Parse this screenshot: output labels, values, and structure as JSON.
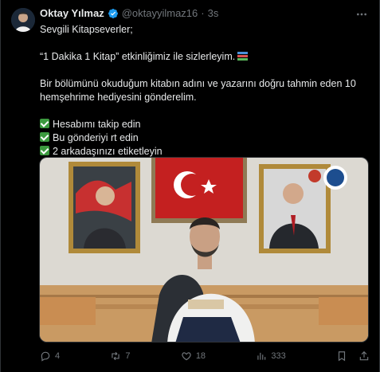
{
  "tweet": {
    "author_name": "Oktay Yılmaz",
    "handle": "@oktayyilmaz16",
    "separator": "·",
    "time": "3s",
    "lines": {
      "greeting": "Sevgili Kitapseverler;",
      "event": "“1 Dakika 1 Kitap” etkinliğimiz ile sizlerleyim.",
      "instruction": "Bir bölümünü okuduğum kitabın adını ve yazarını doğru tahmin eden 10 hemşehrime hediyesini gönderelim.",
      "step1": "Hesabımı takip edin",
      "step2": "Bu gönderiyi rt edin",
      "step3": "2 arkadaşınızı etiketleyin"
    }
  },
  "actions": {
    "replies": "4",
    "reposts": "7",
    "likes": "18",
    "views": "333"
  },
  "icons": {
    "verified": "verified-badge-icon",
    "more": "more-horizontal-icon",
    "reply": "reply-icon",
    "repost": "repost-icon",
    "like": "heart-icon",
    "views": "views-chart-icon",
    "bookmark": "bookmark-icon",
    "share": "share-icon",
    "books": "books-emoji-icon",
    "check": "check-mark-emoji-icon"
  },
  "colors": {
    "background": "#000000",
    "text": "#e7e9ea",
    "muted": "#71767b",
    "verified": "#1d9bf0",
    "check_emoji": "#3c9a3f"
  }
}
